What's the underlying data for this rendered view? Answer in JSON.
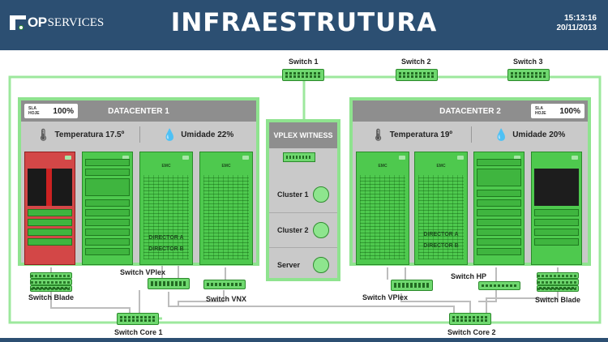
{
  "header": {
    "logo_op": "OP",
    "logo_services": "SERVICES",
    "title": "INFRAESTRUTURA",
    "time": "15:13:16",
    "date": "20/11/2013"
  },
  "top_switches": [
    {
      "label": "Switch 1",
      "status": "ok"
    },
    {
      "label": "Switch 2",
      "status": "ok"
    },
    {
      "label": "Switch 3",
      "status": "ok"
    }
  ],
  "datacenter1": {
    "title": "DATACENTER 1",
    "sla_label": "SLA\nHOJE",
    "sla_value": "100%",
    "temperature": "Temperatura 17.5º",
    "humidity": "Umidade 22%",
    "racks": [
      {
        "status": "alert"
      },
      {
        "status": "ok"
      },
      {
        "status": "ok",
        "brand": "EMC",
        "labels": [
          "DIRECTOR A",
          "DIRECTOR B"
        ]
      },
      {
        "status": "ok",
        "brand": "EMC"
      }
    ],
    "switches": [
      {
        "label": "Switch Blade"
      },
      {
        "label": "Switch VPlex"
      },
      {
        "label": "Switch VNX"
      }
    ]
  },
  "datacenter2": {
    "title": "DATACENTER 2",
    "sla_label": "SLA\nHOJE",
    "sla_value": "100%",
    "temperature": "Temperatura 19º",
    "humidity": "Umidade 20%",
    "racks": [
      {
        "status": "ok",
        "brand": "EMC"
      },
      {
        "status": "ok",
        "brand": "EMC",
        "labels": [
          "DIRECTOR A",
          "DIRECTOR B"
        ]
      },
      {
        "status": "ok"
      },
      {
        "status": "ok"
      }
    ],
    "switches": [
      {
        "label": "Switch VPlex"
      },
      {
        "label": "Switch HP"
      },
      {
        "label": "Switch Blade"
      }
    ]
  },
  "vplex": {
    "title": "VPLEX WITNESS",
    "rows": [
      {
        "label": "Cluster 1",
        "status": "ok"
      },
      {
        "label": "Cluster 2",
        "status": "ok"
      },
      {
        "label": "Server",
        "status": "ok"
      }
    ]
  },
  "core_switches": [
    {
      "label": "Switch Core 1"
    },
    {
      "label": "Switch Core 2"
    }
  ],
  "colors": {
    "header_bg": "#2c4f72",
    "ok_green": "#6fd86f",
    "alert_red": "#d34747",
    "panel_border": "#8fe38f"
  }
}
